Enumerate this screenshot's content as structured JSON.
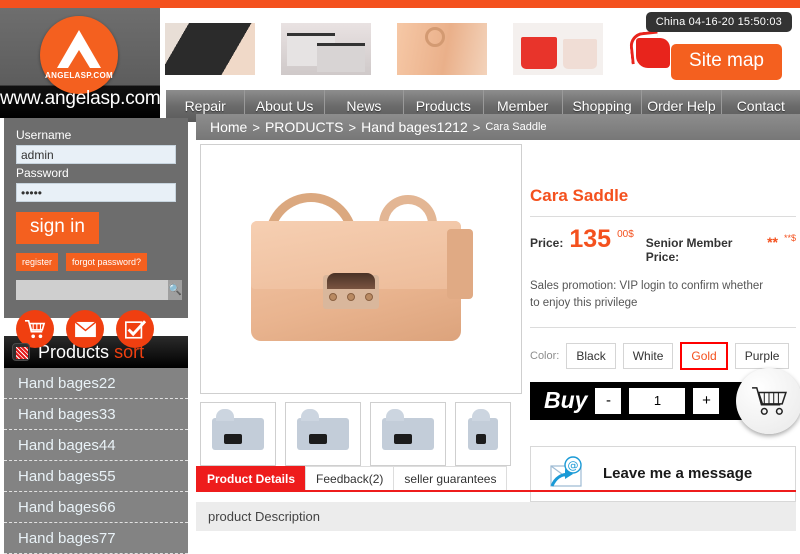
{
  "brand": {
    "logo_text": "ANGELASP.COM",
    "site_url": "www.angelasp.com",
    "logo_icon": "triangle-a-logo"
  },
  "header": {
    "clock": "China 04-16-20 15:50:03",
    "sitemap_label": "Site map",
    "bag_icon": "red-handbag-icon",
    "banner_thumbs": [
      {
        "name": "black-tote-thumb"
      },
      {
        "name": "silver-clutch-thumb"
      },
      {
        "name": "nude-bag-thumb"
      },
      {
        "name": "red-pink-tote-thumb"
      }
    ]
  },
  "nav": {
    "items": [
      {
        "label": "Repair"
      },
      {
        "label": "About Us"
      },
      {
        "label": "News"
      },
      {
        "label": "Products"
      },
      {
        "label": "Member"
      },
      {
        "label": "Shopping"
      },
      {
        "label": "Order Help"
      },
      {
        "label": "Contact"
      }
    ]
  },
  "sidebar": {
    "login": {
      "username_label": "Username",
      "username_value": "admin",
      "username_placeholder": "",
      "password_label": "Password",
      "password_value": "•••••",
      "password_placeholder": "",
      "signin_label": "sign in",
      "register_label": "register",
      "forgot_label": "forgot password?"
    },
    "search": {
      "value": "",
      "placeholder": "",
      "icon": "search-icon"
    },
    "shortcuts": [
      {
        "name": "cart-icon"
      },
      {
        "name": "envelope-icon"
      },
      {
        "name": "checkbox-icon"
      }
    ],
    "sort": {
      "title": "Products",
      "title_accent": "sort",
      "icon": "grid-icon",
      "items": [
        {
          "label": "Hand bages22"
        },
        {
          "label": "Hand bages33"
        },
        {
          "label": "Hand bages44"
        },
        {
          "label": "Hand bages55"
        },
        {
          "label": "Hand bages66"
        },
        {
          "label": "Hand bages77"
        }
      ]
    }
  },
  "breadcrumb": {
    "home": "Home",
    "sep1": ">",
    "category": "PRODUCTS",
    "sep2": ">",
    "subcategory": "Hand bages1212",
    "sep3": ">",
    "current": "Cara Saddle"
  },
  "product": {
    "title": "Cara Saddle",
    "price_label": "Price:",
    "price_value": "135",
    "price_cents": "00$",
    "member_price_label": "Senior Member Price:",
    "member_price_value": "**",
    "member_price_sup": "**$",
    "promotion": "Sales promotion: VIP login to confirm whether to enjoy this privilege",
    "color_label": "Color:",
    "colors": [
      {
        "label": "Black",
        "selected": false
      },
      {
        "label": "White",
        "selected": false
      },
      {
        "label": "Gold",
        "selected": true
      },
      {
        "label": "Purple",
        "selected": false
      }
    ],
    "buy_label": "Buy",
    "qty_minus": "-",
    "qty_value": "1",
    "qty_plus": "+",
    "cart_icon": "shopping-cart-icon",
    "message_icon": "email-at-icon",
    "message_label": "Leave me a message",
    "main_image_name": "peach-saddle-bag-image",
    "thumbnails": [
      {
        "name": "product-thumb-1"
      },
      {
        "name": "product-thumb-2"
      },
      {
        "name": "product-thumb-3"
      },
      {
        "name": "product-thumb-4"
      }
    ]
  },
  "tabs": {
    "items": [
      {
        "label": "Product Details",
        "active": true
      },
      {
        "label": "Feedback(2)",
        "active": false
      },
      {
        "label": "seller guarantees",
        "active": false
      }
    ],
    "description_heading": "product Description"
  },
  "colors": {
    "accent_orange": "#f4601f",
    "accent_red": "#ee1c1c",
    "price_red": "#f4511e",
    "sidebar_gray": "#838383",
    "nav_gray": "#6b6b6b"
  }
}
